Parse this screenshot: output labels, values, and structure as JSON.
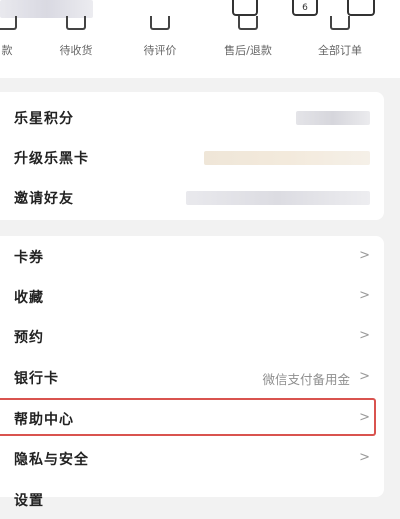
{
  "header": {
    "calendar_badge": "6"
  },
  "order_tabs": [
    {
      "label": "款",
      "icon": "payment-icon"
    },
    {
      "label": "待收货",
      "icon": "truck-icon"
    },
    {
      "label": "待评价",
      "icon": "review-icon"
    },
    {
      "label": "售后/退款",
      "icon": "refund-icon"
    },
    {
      "label": "全部订单",
      "icon": "orders-icon"
    }
  ],
  "member_card": {
    "items": [
      {
        "label": "乐星积分"
      },
      {
        "label": "升级乐黑卡"
      },
      {
        "label": "邀请好友"
      }
    ]
  },
  "menu": {
    "items": [
      {
        "label": "卡券",
        "value": "",
        "chevron": ">"
      },
      {
        "label": "收藏",
        "value": "",
        "chevron": ">"
      },
      {
        "label": "预约",
        "value": "",
        "chevron": ">"
      },
      {
        "label": "银行卡",
        "value": "微信支付备用金",
        "chevron": ">"
      },
      {
        "label": "帮助中心",
        "value": "",
        "chevron": ">",
        "highlighted": true
      },
      {
        "label": "隐私与安全",
        "value": "",
        "chevron": ">"
      },
      {
        "label": "设置",
        "value": "",
        "chevron": ""
      }
    ]
  },
  "colors": {
    "highlight_border": "#d9534f",
    "background": "#f2f2f2",
    "card": "#ffffff"
  }
}
